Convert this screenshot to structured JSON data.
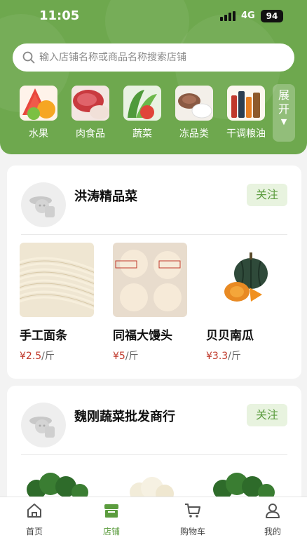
{
  "status": {
    "time": "11:05",
    "network": "4G",
    "battery": "94"
  },
  "search": {
    "placeholder": "输入店铺名称或商品名称搜索店铺"
  },
  "categories": [
    {
      "label": "水果",
      "icon": "fruit-icon"
    },
    {
      "label": "肉食品",
      "icon": "meat-icon"
    },
    {
      "label": "蔬菜",
      "icon": "vegetable-icon"
    },
    {
      "label": "冻品类",
      "icon": "frozen-food-icon"
    },
    {
      "label": "干调粮油",
      "icon": "grain-oil-icon"
    }
  ],
  "expand_label": "展开",
  "stores": [
    {
      "name": "洪涛精品菜",
      "follow_label": "关注",
      "products": [
        {
          "name": "手工面条",
          "price": "¥2.5",
          "unit": "/斤"
        },
        {
          "name": "同福大馒头",
          "price": "¥5",
          "unit": "/斤"
        },
        {
          "name": "贝贝南瓜",
          "price": "¥3.3",
          "unit": "/斤"
        }
      ]
    },
    {
      "name": "魏刚蔬菜批发商行",
      "follow_label": "关注",
      "products": [
        {
          "name": "西兰花"
        },
        {
          "name": "花菜"
        },
        {
          "name": "西兰花"
        }
      ]
    }
  ],
  "tabs": [
    {
      "label": "首页",
      "icon": "home-icon"
    },
    {
      "label": "店铺",
      "icon": "store-icon"
    },
    {
      "label": "购物车",
      "icon": "cart-icon"
    },
    {
      "label": "我的",
      "icon": "profile-icon"
    }
  ],
  "colors": {
    "brand_green": "#6ea84e",
    "follow_text": "#5b9c3e",
    "follow_bg": "#e8f3df",
    "price_red": "#c0392b"
  }
}
